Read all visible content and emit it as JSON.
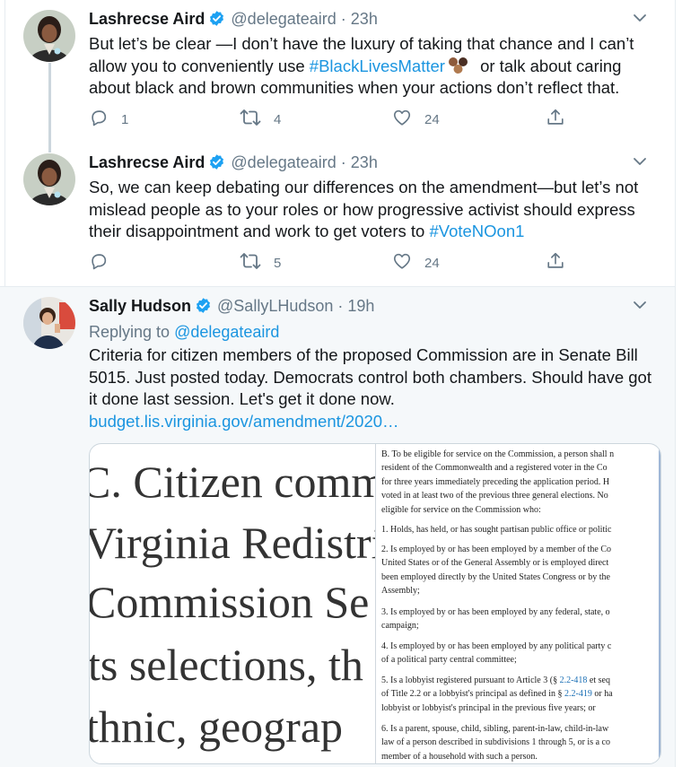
{
  "tweets": [
    {
      "name": "Lashrecse Aird",
      "handle": "@delegateaird",
      "sep": "·",
      "time": "23h",
      "text_pre": "But let’s be clear —I don’t have the luxury of taking that chance and I can’t allow you to conveniently use ",
      "hashtag": "#BlackLivesMatter",
      "text_post": " or talk about caring about black and brown communities when your actions don’t reflect that.",
      "replies": "1",
      "retweets": "4",
      "likes": "24"
    },
    {
      "name": "Lashrecse Aird",
      "handle": "@delegateaird",
      "sep": "·",
      "time": "23h",
      "text_pre": "So, we can keep debating our differences on the amendment—but let’s not mislead people as to your roles or how progressive activist  should express their disappointment and work to get voters to ",
      "hashtag": "#VoteNOon1",
      "text_post": "",
      "replies": "",
      "retweets": "5",
      "likes": "24"
    },
    {
      "name": "Sally Hudson",
      "handle": "@SallyLHudson",
      "sep": "·",
      "time": "19h",
      "reply_label": "Replying to",
      "reply_handle": "@delegateaird",
      "text": "Criteria for citizen members of the proposed Commission are in Senate Bill 5015. Just posted today. Democrats control both chambers. Should have got it done last session. Let's get it done now.",
      "url": "budget.lis.virginia.gov/amendment/2020…"
    }
  ],
  "card": {
    "big_lines": [
      "C. Citizen comm",
      "Virginia Redistri",
      "Commission Se",
      "ts selections, th",
      "thnic, geograp"
    ],
    "doc": {
      "p1": [
        "B. To be eligible for service on the Commission, a person shall n",
        "resident of the Commonwealth and a registered voter in the Co",
        "for three years immediately preceding the application period. H",
        "voted in at least two of the previous three general elections. No",
        "eligible for service on the Commission who:"
      ],
      "p2": [
        "1. Holds, has held, or has sought partisan public office or politic"
      ],
      "p3": [
        "2. Is employed by or has been employed by a member of the Co",
        "United States or of the General Assembly or is employed direct",
        "been employed directly by the United States Congress or by the",
        "Assembly;"
      ],
      "p4": [
        "3. Is employed by or has been employed by any federal, state, o",
        "campaign;"
      ],
      "p5": [
        "4. Is employed by or has been employed by any political party c",
        "of a political party central committee;"
      ],
      "p6a_pre": "5. Is a lobbyist registered pursuant to Article 3 (§ ",
      "p6a_link": "2.2-418",
      "p6a_post": " et seq",
      "p6b_pre": "of Title 2.2 or a lobbyist's principal as defined in § ",
      "p6b_link": "2.2-419",
      "p6b_post": " or ha",
      "p6c": "lobbyist or lobbyist's principal in the previous five years; or",
      "p7": [
        "6. Is a parent, spouse, child, sibling, parent-in-law, child-in-law",
        "law of a person described in subdivisions 1 through 5, or is a co",
        "member of a household with such a person."
      ]
    }
  },
  "colors": {
    "accent": "#1b95e0",
    "muted": "#657786",
    "text": "#14171a",
    "selected_bg": "#f5f8fa"
  },
  "icons": [
    "verified-badge-icon",
    "chevron-down-icon",
    "reply-icon",
    "retweet-icon",
    "like-icon",
    "share-icon",
    "emoji-skin-tones-icon"
  ]
}
